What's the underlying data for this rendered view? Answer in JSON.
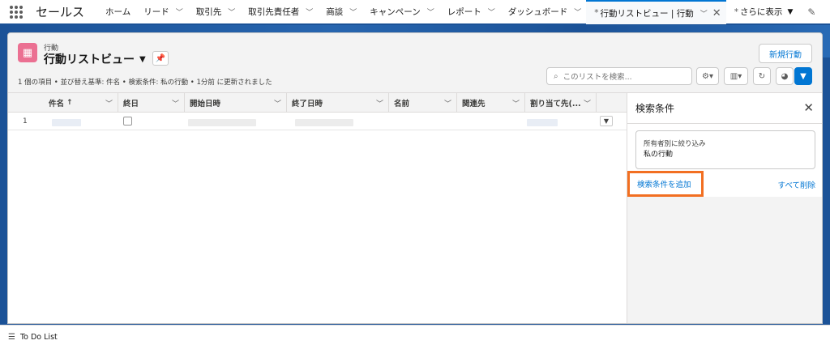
{
  "nav": {
    "app_name": "セールス",
    "items": [
      {
        "label": "ホーム",
        "has_menu": false
      },
      {
        "label": "リード",
        "has_menu": true
      },
      {
        "label": "取引先",
        "has_menu": true
      },
      {
        "label": "取引先責任者",
        "has_menu": true
      },
      {
        "label": "商談",
        "has_menu": true
      },
      {
        "label": "キャンペーン",
        "has_menu": true
      },
      {
        "label": "レポート",
        "has_menu": true
      },
      {
        "label": "ダッシュボード",
        "has_menu": true
      }
    ],
    "active_tab": {
      "marker": "*",
      "label": "行動リストビュー | 行動"
    },
    "more": {
      "marker": "*",
      "label": "さらに表示"
    }
  },
  "header": {
    "object_label": "行動",
    "view_name": "行動リストビュー",
    "new_button": "新規行動",
    "meta": "1 個の項目 • 並び替え基準: 件名 • 検索条件: 私の行動 • 1分前 に更新されました",
    "search_placeholder": "このリストを検索..."
  },
  "table": {
    "columns": [
      "件名",
      "終日",
      "開始日時",
      "終了日時",
      "名前",
      "関連先",
      "割り当て先(..."
    ],
    "sort_indicator": "↑",
    "rows": [
      {
        "number": "1"
      }
    ]
  },
  "filter_panel": {
    "title": "検索条件",
    "filter_box_line1": "所有者別に絞り込み",
    "filter_box_line2": "私の行動",
    "add_filter": "検索条件を追加",
    "remove_all": "すべて削除"
  },
  "footer": {
    "todo_label": "To Do List"
  },
  "colors": {
    "brand_band": "#1b5297",
    "accent": "#0176d3",
    "highlight": "#f26f21",
    "object_icon": "#eb7092"
  }
}
